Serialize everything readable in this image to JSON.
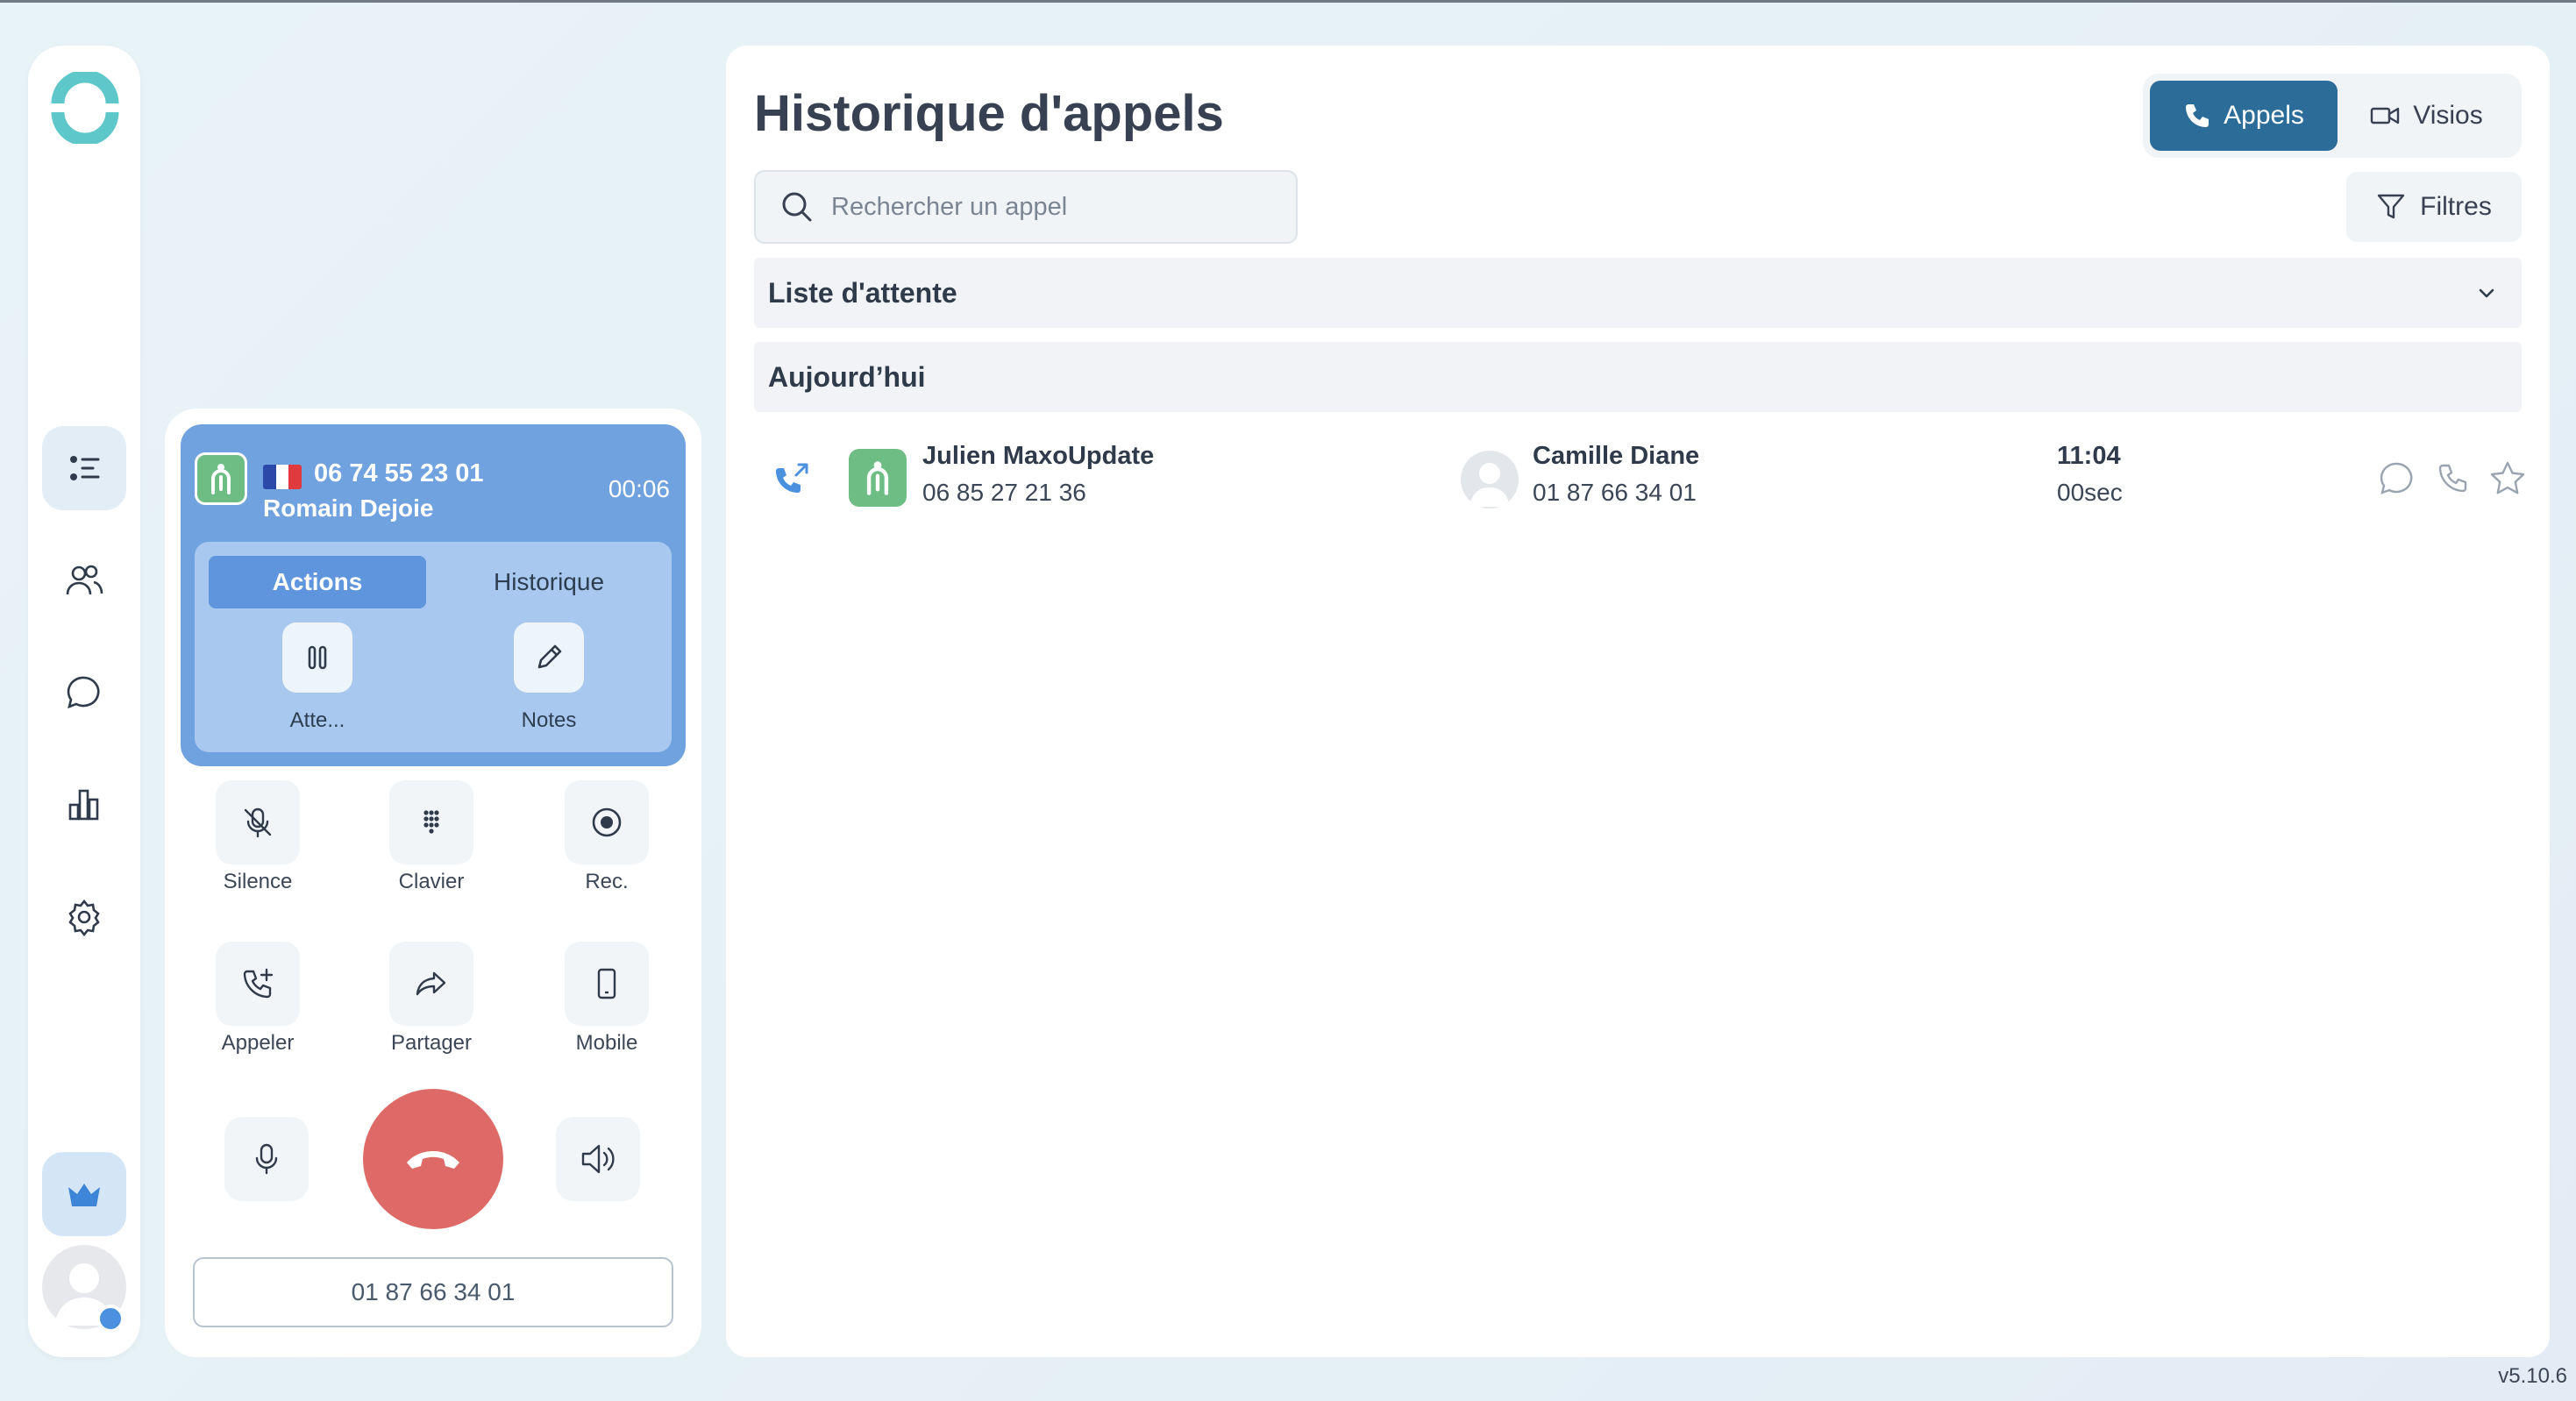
{
  "colors": {
    "accent": "#2c6c99",
    "call_card": "#71a2e0",
    "call_inner": "#a8c8ef",
    "hangup": "#dd6a67",
    "app_badge": "#6dbd84"
  },
  "sidebar": {
    "items": [
      {
        "icon": "list-icon",
        "active": true
      },
      {
        "icon": "contacts-icon",
        "active": false
      },
      {
        "icon": "chat-bubble-icon",
        "active": false
      },
      {
        "icon": "bar-chart-icon",
        "active": false
      },
      {
        "icon": "gear-icon",
        "active": false
      }
    ],
    "premium_icon": "crown-icon",
    "avatar_icon": "user-avatar-icon"
  },
  "call": {
    "number": "06 74 55 23 01",
    "name": "Romain Dejoie",
    "timer": "00:06",
    "tabs": {
      "actions": "Actions",
      "historique": "Historique"
    },
    "actions": {
      "hold": "Atte...",
      "notes": "Notes"
    },
    "controls": {
      "silence": "Silence",
      "clavier": "Clavier",
      "rec": "Rec.",
      "appeler": "Appeler",
      "partager": "Partager",
      "mobile": "Mobile"
    },
    "caller_line": "01 87 66 34 01"
  },
  "main": {
    "title": "Historique d'appels",
    "segments": {
      "appels": "Appels",
      "visios": "Visios"
    },
    "search": {
      "placeholder": "Rechercher un appel"
    },
    "filters_label": "Filtres",
    "sections": {
      "queue": "Liste d'attente",
      "today": "Aujourd’hui"
    },
    "rows": [
      {
        "caller_name": "Julien MaxoUpdate",
        "caller_number": "06 85 27 21 36",
        "callee_name": "Camille Diane",
        "callee_number": "01 87 66 34 01",
        "time": "11:04",
        "duration": "00sec",
        "direction_icon": "outgoing-call-icon"
      }
    ]
  },
  "version": "v5.10.6"
}
